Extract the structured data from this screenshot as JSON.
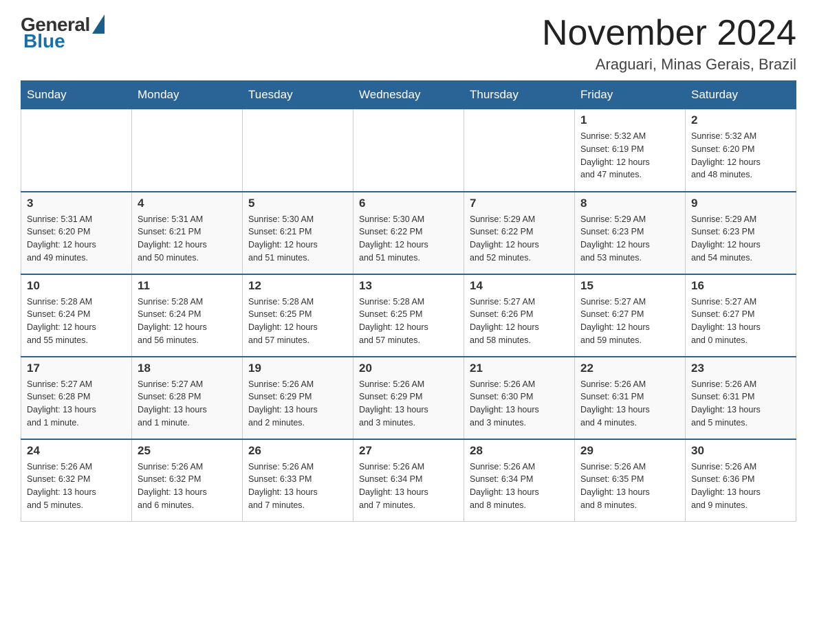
{
  "header": {
    "logo": {
      "general": "General",
      "blue": "Blue"
    },
    "title": "November 2024",
    "location": "Araguari, Minas Gerais, Brazil"
  },
  "days_of_week": [
    "Sunday",
    "Monday",
    "Tuesday",
    "Wednesday",
    "Thursday",
    "Friday",
    "Saturday"
  ],
  "weeks": [
    {
      "days": [
        {
          "number": "",
          "info": ""
        },
        {
          "number": "",
          "info": ""
        },
        {
          "number": "",
          "info": ""
        },
        {
          "number": "",
          "info": ""
        },
        {
          "number": "",
          "info": ""
        },
        {
          "number": "1",
          "info": "Sunrise: 5:32 AM\nSunset: 6:19 PM\nDaylight: 12 hours\nand 47 minutes."
        },
        {
          "number": "2",
          "info": "Sunrise: 5:32 AM\nSunset: 6:20 PM\nDaylight: 12 hours\nand 48 minutes."
        }
      ]
    },
    {
      "days": [
        {
          "number": "3",
          "info": "Sunrise: 5:31 AM\nSunset: 6:20 PM\nDaylight: 12 hours\nand 49 minutes."
        },
        {
          "number": "4",
          "info": "Sunrise: 5:31 AM\nSunset: 6:21 PM\nDaylight: 12 hours\nand 50 minutes."
        },
        {
          "number": "5",
          "info": "Sunrise: 5:30 AM\nSunset: 6:21 PM\nDaylight: 12 hours\nand 51 minutes."
        },
        {
          "number": "6",
          "info": "Sunrise: 5:30 AM\nSunset: 6:22 PM\nDaylight: 12 hours\nand 51 minutes."
        },
        {
          "number": "7",
          "info": "Sunrise: 5:29 AM\nSunset: 6:22 PM\nDaylight: 12 hours\nand 52 minutes."
        },
        {
          "number": "8",
          "info": "Sunrise: 5:29 AM\nSunset: 6:23 PM\nDaylight: 12 hours\nand 53 minutes."
        },
        {
          "number": "9",
          "info": "Sunrise: 5:29 AM\nSunset: 6:23 PM\nDaylight: 12 hours\nand 54 minutes."
        }
      ]
    },
    {
      "days": [
        {
          "number": "10",
          "info": "Sunrise: 5:28 AM\nSunset: 6:24 PM\nDaylight: 12 hours\nand 55 minutes."
        },
        {
          "number": "11",
          "info": "Sunrise: 5:28 AM\nSunset: 6:24 PM\nDaylight: 12 hours\nand 56 minutes."
        },
        {
          "number": "12",
          "info": "Sunrise: 5:28 AM\nSunset: 6:25 PM\nDaylight: 12 hours\nand 57 minutes."
        },
        {
          "number": "13",
          "info": "Sunrise: 5:28 AM\nSunset: 6:25 PM\nDaylight: 12 hours\nand 57 minutes."
        },
        {
          "number": "14",
          "info": "Sunrise: 5:27 AM\nSunset: 6:26 PM\nDaylight: 12 hours\nand 58 minutes."
        },
        {
          "number": "15",
          "info": "Sunrise: 5:27 AM\nSunset: 6:27 PM\nDaylight: 12 hours\nand 59 minutes."
        },
        {
          "number": "16",
          "info": "Sunrise: 5:27 AM\nSunset: 6:27 PM\nDaylight: 13 hours\nand 0 minutes."
        }
      ]
    },
    {
      "days": [
        {
          "number": "17",
          "info": "Sunrise: 5:27 AM\nSunset: 6:28 PM\nDaylight: 13 hours\nand 1 minute."
        },
        {
          "number": "18",
          "info": "Sunrise: 5:27 AM\nSunset: 6:28 PM\nDaylight: 13 hours\nand 1 minute."
        },
        {
          "number": "19",
          "info": "Sunrise: 5:26 AM\nSunset: 6:29 PM\nDaylight: 13 hours\nand 2 minutes."
        },
        {
          "number": "20",
          "info": "Sunrise: 5:26 AM\nSunset: 6:29 PM\nDaylight: 13 hours\nand 3 minutes."
        },
        {
          "number": "21",
          "info": "Sunrise: 5:26 AM\nSunset: 6:30 PM\nDaylight: 13 hours\nand 3 minutes."
        },
        {
          "number": "22",
          "info": "Sunrise: 5:26 AM\nSunset: 6:31 PM\nDaylight: 13 hours\nand 4 minutes."
        },
        {
          "number": "23",
          "info": "Sunrise: 5:26 AM\nSunset: 6:31 PM\nDaylight: 13 hours\nand 5 minutes."
        }
      ]
    },
    {
      "days": [
        {
          "number": "24",
          "info": "Sunrise: 5:26 AM\nSunset: 6:32 PM\nDaylight: 13 hours\nand 5 minutes."
        },
        {
          "number": "25",
          "info": "Sunrise: 5:26 AM\nSunset: 6:32 PM\nDaylight: 13 hours\nand 6 minutes."
        },
        {
          "number": "26",
          "info": "Sunrise: 5:26 AM\nSunset: 6:33 PM\nDaylight: 13 hours\nand 7 minutes."
        },
        {
          "number": "27",
          "info": "Sunrise: 5:26 AM\nSunset: 6:34 PM\nDaylight: 13 hours\nand 7 minutes."
        },
        {
          "number": "28",
          "info": "Sunrise: 5:26 AM\nSunset: 6:34 PM\nDaylight: 13 hours\nand 8 minutes."
        },
        {
          "number": "29",
          "info": "Sunrise: 5:26 AM\nSunset: 6:35 PM\nDaylight: 13 hours\nand 8 minutes."
        },
        {
          "number": "30",
          "info": "Sunrise: 5:26 AM\nSunset: 6:36 PM\nDaylight: 13 hours\nand 9 minutes."
        }
      ]
    }
  ]
}
